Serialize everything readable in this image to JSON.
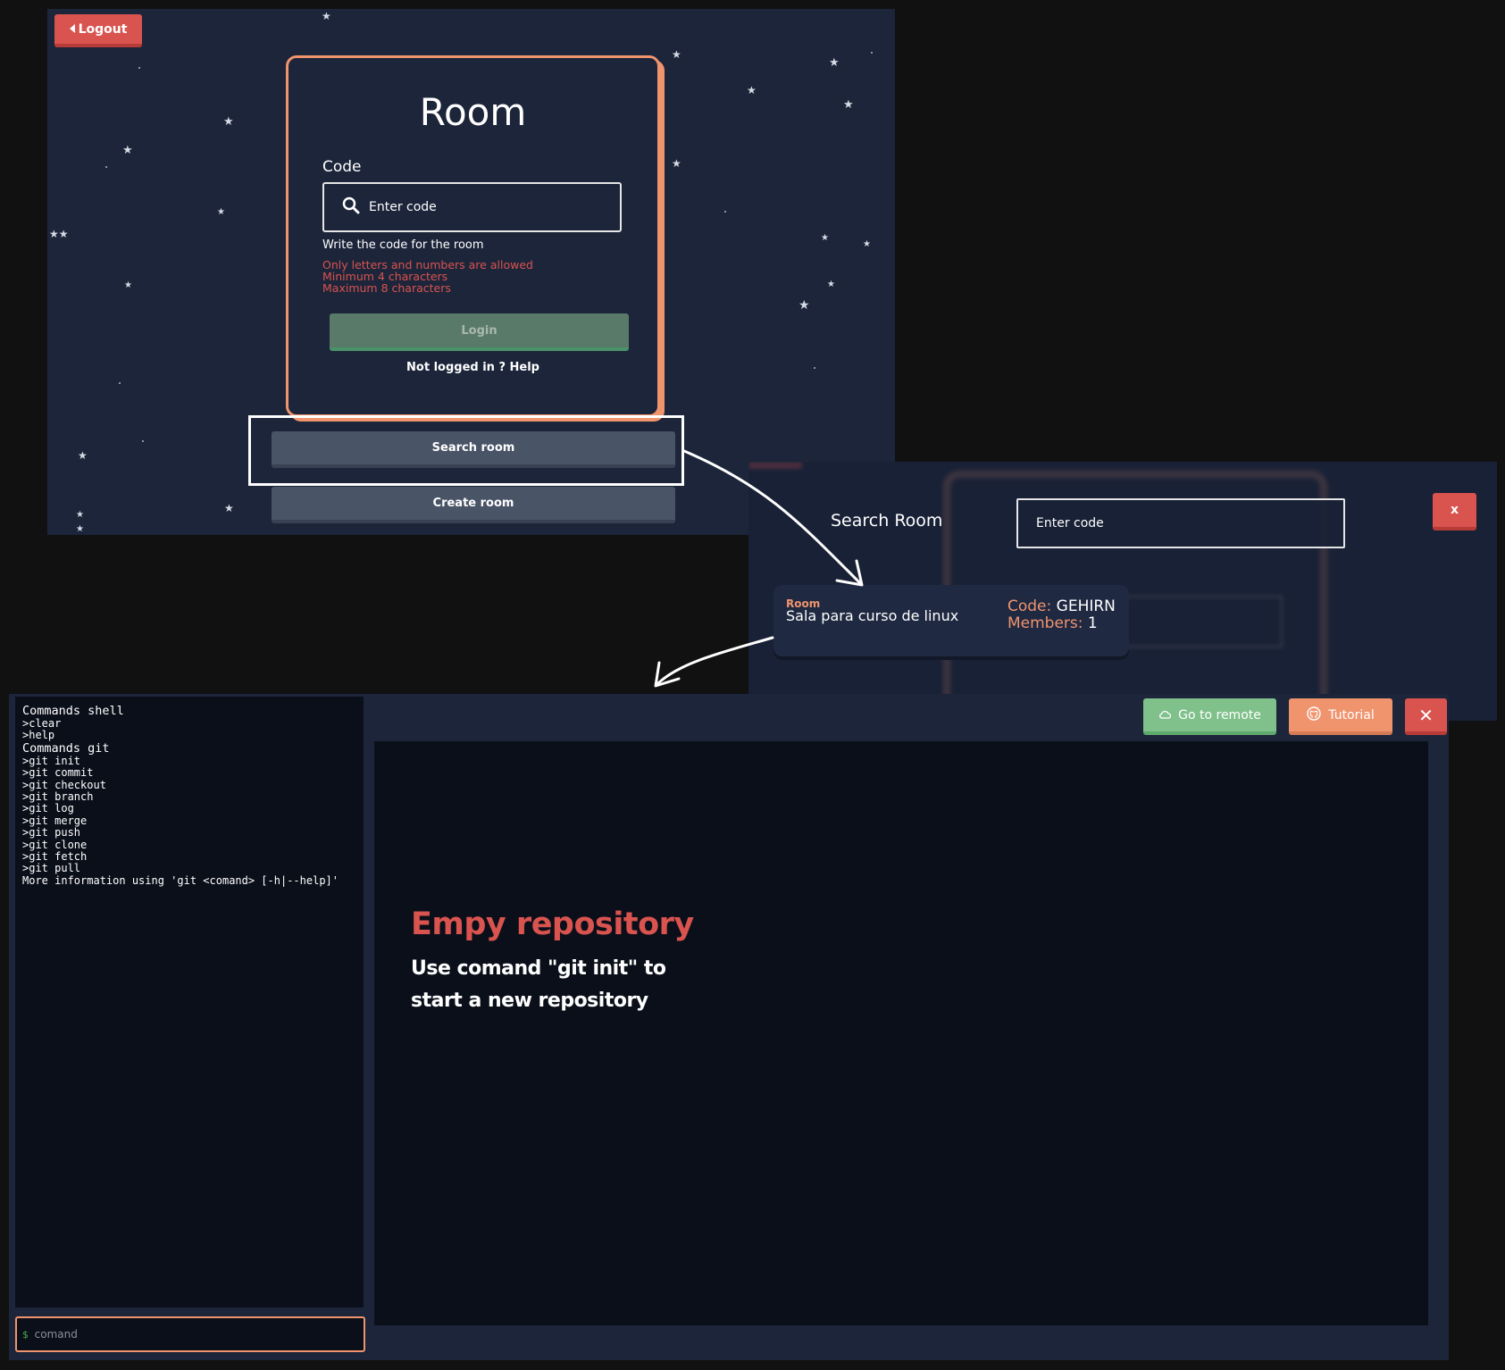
{
  "login_screen": {
    "logout_label": "Logout",
    "title": "Room",
    "code_label": "Code",
    "code_placeholder": "Enter code",
    "help_text": "Write the code for the room",
    "errors": [
      "Only letters and numbers are allowed",
      "Minimum 4 characters",
      "Maximum 8 characters"
    ],
    "login_label": "Login",
    "not_logged_text": "Not logged in ? Help",
    "search_room_label": "Search room",
    "create_room_label": "Create room"
  },
  "search_modal": {
    "title": "Search Room",
    "input_placeholder": "Enter code",
    "close_label": "x",
    "result": {
      "tag": "Room",
      "name": "Sala para curso de linux",
      "code_label": "Code:",
      "code_value": "GEHIRN",
      "members_label": "Members:",
      "members_value": "1"
    }
  },
  "simulator": {
    "terminal_lines": [
      {
        "text": "Commands shell",
        "head": true
      },
      {
        "text": ">clear"
      },
      {
        "text": ">help"
      },
      {
        "text": "Commands git",
        "head": true
      },
      {
        "text": ">git init"
      },
      {
        "text": ">git commit"
      },
      {
        "text": ">git checkout"
      },
      {
        "text": ">git branch"
      },
      {
        "text": ">git log"
      },
      {
        "text": ">git merge"
      },
      {
        "text": ">git push"
      },
      {
        "text": ">git clone"
      },
      {
        "text": ">git fetch"
      },
      {
        "text": ">git pull"
      },
      {
        "text": "More information using 'git <comand> [-h|--help]'"
      }
    ],
    "prompt_symbol": "$",
    "command_placeholder": "comand",
    "go_remote_label": "Go to remote",
    "tutorial_label": "Tutorial",
    "close_label": "✕",
    "empty_title": "Empy repository",
    "empty_text": "Use comand \"git init\" to start a new repository"
  },
  "colors": {
    "accent_orange": "#f0946e",
    "danger_red": "#d9534f",
    "success_green": "#7fc08b",
    "panel_navy": "#1c253a",
    "terminal_black": "#0b0f1a"
  },
  "icons": {
    "logout": "chevron-left-icon",
    "search": "search-icon",
    "remote": "cloud-icon",
    "tutorial": "github-icon",
    "close": "close-icon"
  }
}
